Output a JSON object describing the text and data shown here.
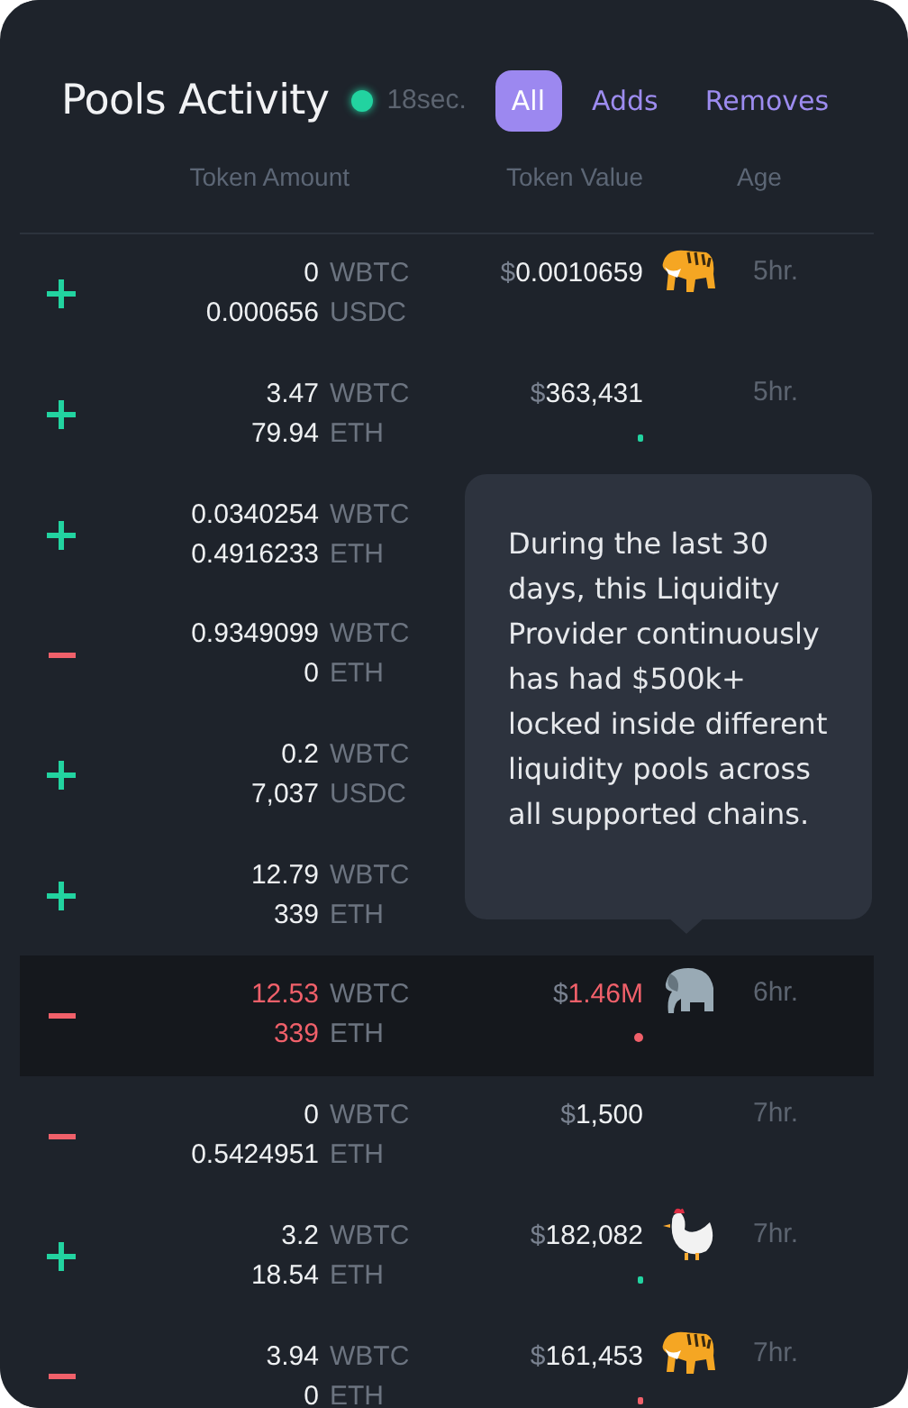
{
  "header": {
    "title": "Pools Activity",
    "live": true,
    "updated": "18sec.",
    "filters": [
      {
        "label": "All",
        "selected": true
      },
      {
        "label": "Adds",
        "selected": false
      },
      {
        "label": "Removes",
        "selected": false
      }
    ]
  },
  "columns": [
    "Token Amount",
    "Token Value",
    "Age"
  ],
  "rows": [
    {
      "kind": "add",
      "selected": false,
      "amounts": [
        {
          "value": "0",
          "token": "WBTC"
        },
        {
          "value": "0.000656",
          "token": "USDC"
        }
      ],
      "currency": "$",
      "value": "0.0010659",
      "icon": {
        "kind": "tiger"
      },
      "age": "5hr."
    },
    {
      "kind": "add",
      "selected": false,
      "amounts": [
        {
          "value": "3.47",
          "token": "WBTC"
        },
        {
          "value": "79.94",
          "token": "ETH"
        }
      ],
      "currency": "$",
      "value": "363,431",
      "bar": true,
      "age": "5hr."
    },
    {
      "kind": "add",
      "selected": false,
      "amounts": [
        {
          "value": "0.0340254",
          "token": "WBTC"
        },
        {
          "value": "0.4916233",
          "token": "ETH"
        }
      ]
    },
    {
      "kind": "remove",
      "selected": false,
      "amounts": [
        {
          "value": "0.9349099",
          "token": "WBTC"
        },
        {
          "value": "0",
          "token": "ETH"
        }
      ]
    },
    {
      "kind": "add",
      "selected": false,
      "amounts": [
        {
          "value": "0.2",
          "token": "WBTC"
        },
        {
          "value": "7,037",
          "token": "USDC"
        }
      ]
    },
    {
      "kind": "add",
      "selected": false,
      "amounts": [
        {
          "value": "12.79",
          "token": "WBTC"
        },
        {
          "value": "339",
          "token": "ETH"
        }
      ]
    },
    {
      "kind": "remove",
      "selected": true,
      "amounts": [
        {
          "value": "12.53",
          "token": "WBTC"
        },
        {
          "value": "339",
          "token": "ETH"
        }
      ],
      "currency": "$",
      "value": "1.46M",
      "bar": true,
      "icon": {
        "kind": "elephant"
      },
      "age": "6hr."
    },
    {
      "kind": "remove",
      "selected": false,
      "amounts": [
        {
          "value": "0",
          "token": "WBTC"
        },
        {
          "value": "0.5424951",
          "token": "ETH"
        }
      ],
      "currency": "$",
      "value": "1,500",
      "age": "7hr."
    },
    {
      "kind": "add",
      "selected": false,
      "amounts": [
        {
          "value": "3.2",
          "token": "WBTC"
        },
        {
          "value": "18.54",
          "token": "ETH"
        }
      ],
      "currency": "$",
      "value": "182,082",
      "bar": true,
      "icon": {
        "kind": "chicken"
      },
      "age": "7hr."
    },
    {
      "kind": "remove",
      "selected": false,
      "amounts": [
        {
          "value": "3.94",
          "token": "WBTC"
        },
        {
          "value": "0",
          "token": "ETH"
        }
      ],
      "currency": "$",
      "value": "161,453",
      "bar": true,
      "icon": {
        "kind": "tiger"
      },
      "age": "7hr."
    }
  ],
  "tooltip": {
    "text": "During the last 30 days, this Liquidity Provider continuously has had $500k+ locked inside different liquidity pools across all supported chains."
  }
}
